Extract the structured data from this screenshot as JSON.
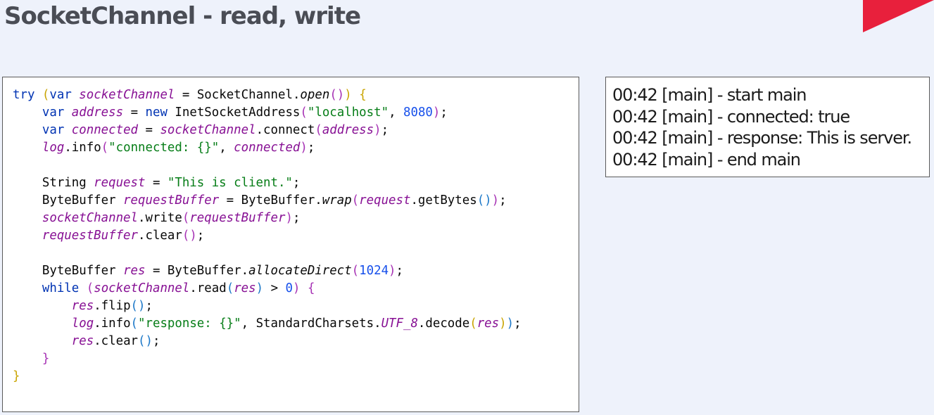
{
  "slide": {
    "title": "SocketChannel - read, write",
    "accent_color": "#e8203c"
  },
  "code": {
    "language": "java",
    "lines": [
      "try (var socketChannel = SocketChannel.open()) {",
      "    var address = new InetSocketAddress(\"localhost\", 8080);",
      "    var connected = socketChannel.connect(address);",
      "    log.info(\"connected: {}\", connected);",
      "",
      "    String request = \"This is client.\";",
      "    ByteBuffer requestBuffer = ByteBuffer.wrap(request.getBytes());",
      "    socketChannel.write(requestBuffer);",
      "    requestBuffer.clear();",
      "",
      "    ByteBuffer res = ByteBuffer.allocateDirect(1024);",
      "    while (socketChannel.read(res) > 0) {",
      "        res.flip();",
      "        log.info(\"response: {}\", StandardCharsets.UTF_8.decode(res));",
      "        res.clear();",
      "    }",
      "}"
    ]
  },
  "console": {
    "lines": [
      "00:42 [main] - start main",
      "00:42 [main] - connected: true",
      "00:42 [main] - response: This is server.",
      "00:42 [main] - end main"
    ]
  }
}
